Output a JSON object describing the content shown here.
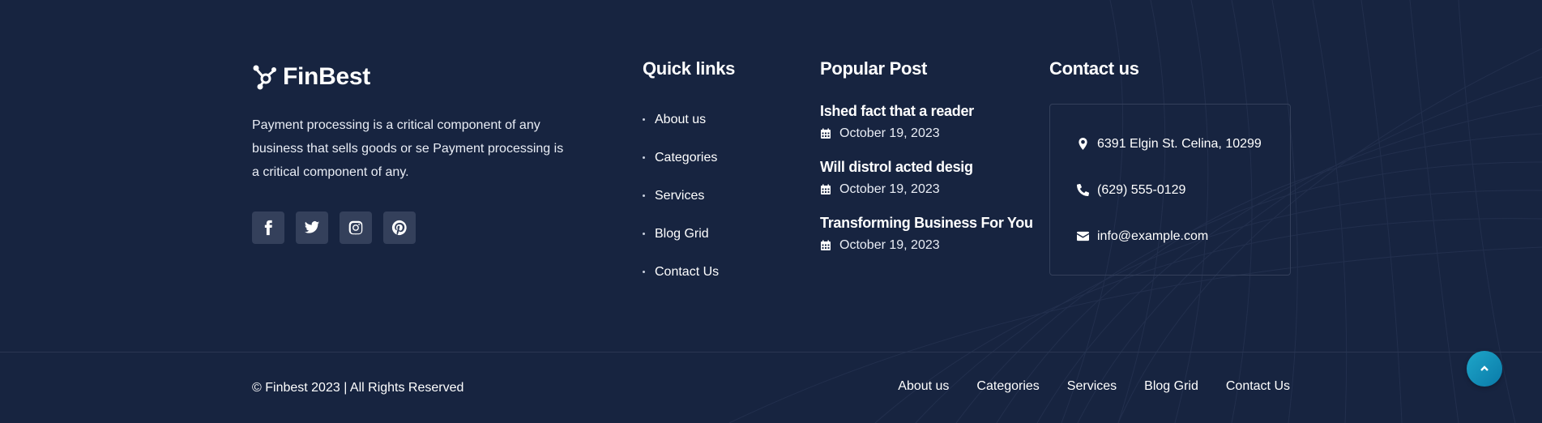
{
  "brand": {
    "name": "FinBest",
    "description": "Payment processing is a critical component of any business that sells goods or se Payment processing is a critical component of any.",
    "socials": [
      "facebook-icon",
      "twitter-icon",
      "instagram-icon",
      "pinterest-icon"
    ]
  },
  "quick_links": {
    "title": "Quick links",
    "items": [
      "About us",
      "Categories",
      "Services",
      "Blog Grid",
      "Contact Us"
    ]
  },
  "popular_post": {
    "title": "Popular Post",
    "posts": [
      {
        "title": "Ished fact that a reader",
        "date": "October 19, 2023"
      },
      {
        "title": "Will distrol acted desig",
        "date": "October 19, 2023"
      },
      {
        "title": "Transforming Business For You",
        "date": "October 19, 2023"
      }
    ]
  },
  "contact": {
    "title": "Contact us",
    "address": "6391 Elgin St. Celina, 10299",
    "phone": "(629) 555-0129",
    "email": "info@example.com"
  },
  "bottom": {
    "copyright": "© Finbest 2023 | All Rights Reserved",
    "links": [
      "About us",
      "Categories",
      "Services",
      "Blog Grid",
      "Contact Us"
    ]
  },
  "colors": {
    "background": "#172440",
    "social_bg": "#34405b",
    "accent": "#1ea6c9"
  }
}
